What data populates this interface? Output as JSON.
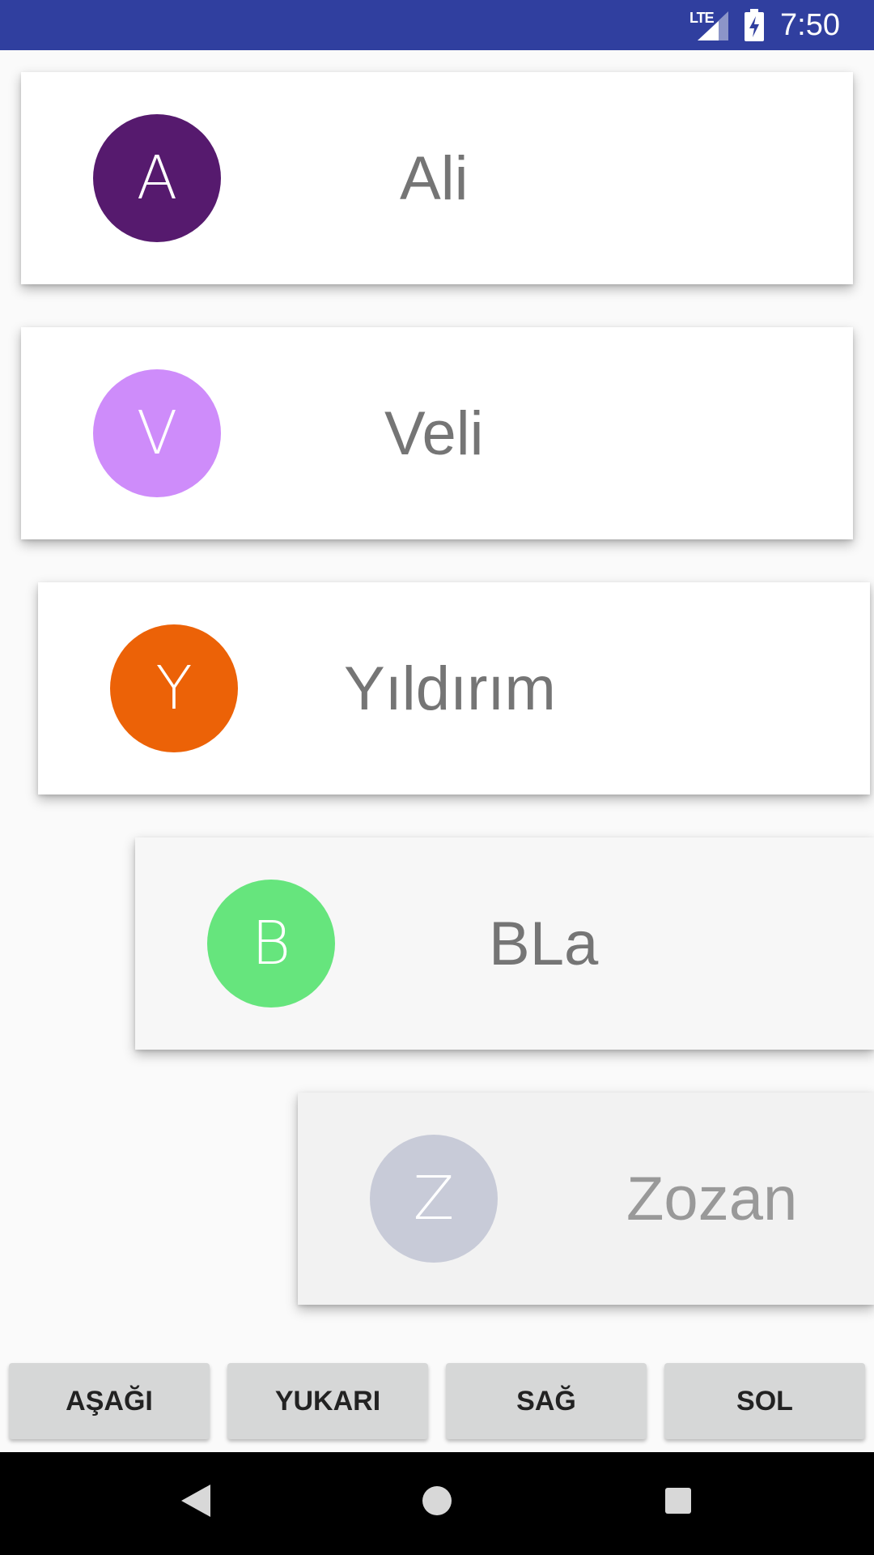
{
  "status_bar": {
    "network_label": "LTE",
    "time": "7:50",
    "background_color": "#303f9f",
    "signal_icon": "signal-icon",
    "battery_icon": "battery-charging-icon"
  },
  "cards": [
    {
      "initial": "A",
      "name": "Ali",
      "avatar_color": "#561a6e",
      "card_color": "#ffffff"
    },
    {
      "initial": "V",
      "name": "Veli",
      "avatar_color": "#ce8cfa",
      "card_color": "#ffffff"
    },
    {
      "initial": "Y",
      "name": "Yıldırım",
      "avatar_color": "#ec6207",
      "card_color": "#ffffff"
    },
    {
      "initial": "B",
      "name": "BLa",
      "avatar_color": "#66e57d",
      "card_color": "#f7f7f7"
    },
    {
      "initial": "Z",
      "name": "Zozan",
      "avatar_color": "#c8cbd8",
      "card_color": "#f2f2f2"
    }
  ],
  "buttons": {
    "down": "AŞAĞI",
    "up": "YUKARI",
    "right": "SAĞ",
    "left": "SOL"
  },
  "nav_bar": {
    "back_icon": "back-icon",
    "home_icon": "home-icon",
    "recents_icon": "recents-icon"
  }
}
